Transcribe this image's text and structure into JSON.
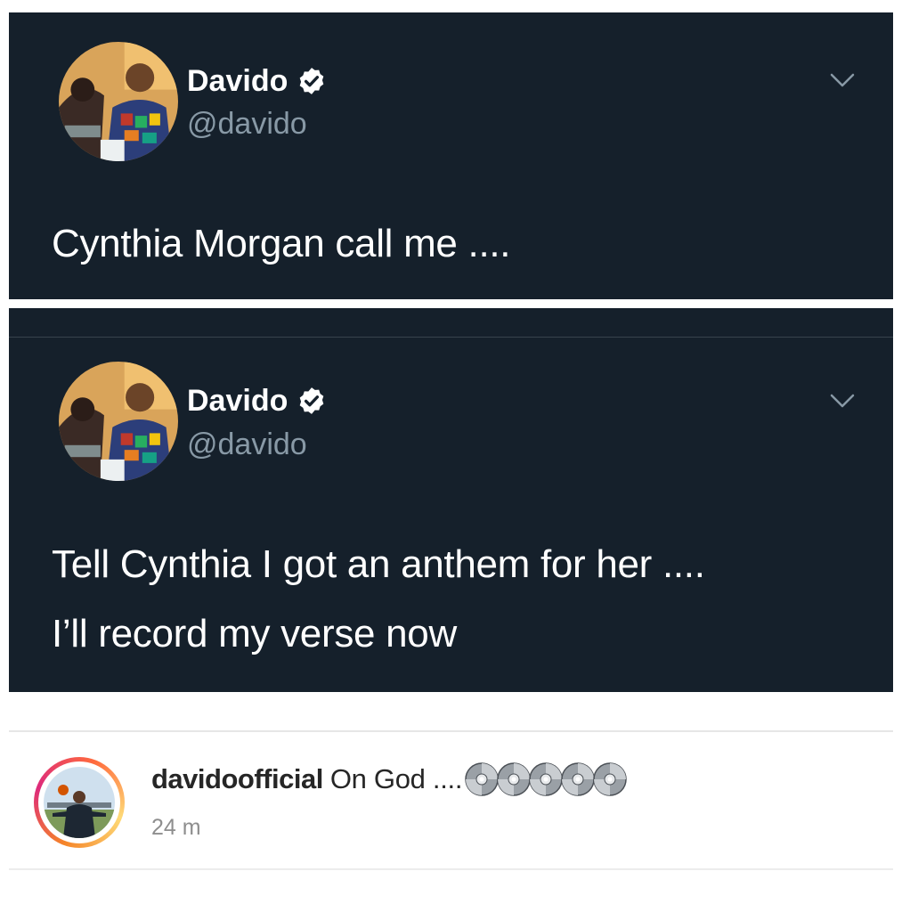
{
  "tweets": [
    {
      "display_name": "Davido",
      "handle": "@davido",
      "verified": true,
      "text_lines": [
        "Cynthia Morgan call me ...."
      ]
    },
    {
      "display_name": "Davido",
      "handle": "@davido",
      "verified": true,
      "text_lines": [
        "Tell Cynthia I got an anthem for her ....",
        "I’ll record my verse now"
      ]
    }
  ],
  "instagram_comment": {
    "username": "davidoofficial",
    "text": "On God ....",
    "emoji_icons": [
      "cd-icon",
      "cd-icon",
      "cd-icon",
      "cd-icon",
      "cd-icon"
    ],
    "time": "24 m"
  },
  "colors": {
    "tweet_background": "#15202b",
    "handle_gray": "#8899a6",
    "verified_badge": "#ffffff",
    "ig_time_gray": "#8e8e8e"
  }
}
